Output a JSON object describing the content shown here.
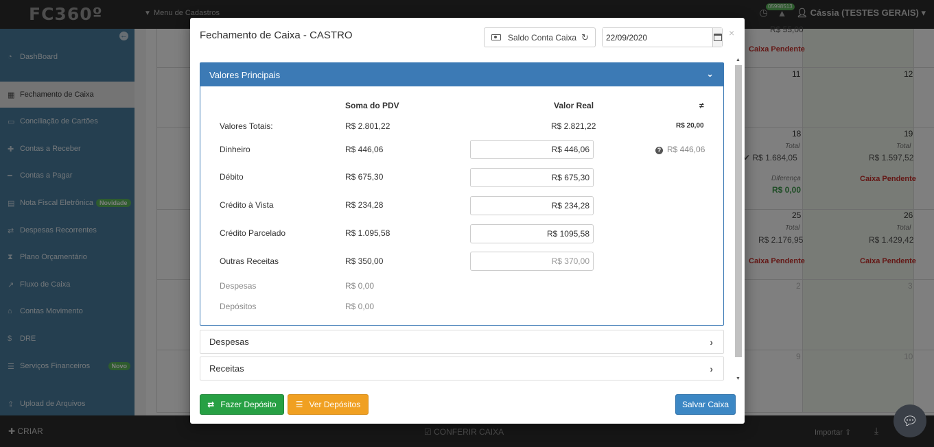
{
  "topbar": {
    "logo": "FC360º",
    "menu_cadastros": "Menu de Cadastros",
    "notification_count": "05998513",
    "user": "Cássia (TESTES GERAIS)"
  },
  "sidebar": {
    "items": [
      {
        "label": "DashBoard",
        "icon": "dashboard-icon"
      },
      {
        "label": "Fechamento de Caixa",
        "icon": "calendar-icon"
      },
      {
        "label": "Conciliação de Cartões",
        "icon": "credit-card-icon"
      },
      {
        "label": "Contas a Receber",
        "icon": "plus-icon"
      },
      {
        "label": "Contas a Pagar",
        "icon": "minus-icon"
      },
      {
        "label": "Nota Fiscal Eletrônica",
        "icon": "document-icon",
        "badge": "Novidade"
      },
      {
        "label": "Despesas Recorrentes",
        "icon": "recurring-icon"
      },
      {
        "label": "Plano Orçamentário",
        "icon": "hourglass-icon"
      },
      {
        "label": "Fluxo de Caixa",
        "icon": "line-chart-icon"
      },
      {
        "label": "Contas Movimento",
        "icon": "bank-icon"
      },
      {
        "label": "DRE",
        "icon": "dollar-icon"
      },
      {
        "label": "Serviços Financeiros",
        "icon": "list-icon",
        "badge": "Novo"
      },
      {
        "label": "Upload de Arquivos",
        "icon": "upload-icon"
      }
    ]
  },
  "bottombar": {
    "criar": "CRIAR",
    "conferir": "CONFERIR CAIXA",
    "importar": "Importar"
  },
  "calendar": {
    "days_row1": [
      "11",
      "12"
    ],
    "days_row2": [
      "18",
      "19"
    ],
    "days_row3": [
      "25",
      "26"
    ],
    "days_row4": [
      "2",
      "3"
    ],
    "days_row5": [
      "9",
      "10"
    ],
    "top_value": "R$ 55,00",
    "caixa_pendente": "Caixa Pendente",
    "total_label": "Total",
    "diferenca_label": "Diferença",
    "d18_total": "R$ 1.684,05",
    "d18_diff": "R$ 0,00",
    "d19_total": "R$ 1.597,52",
    "d25_total": "R$ 2.176,95",
    "d26_total": "R$ 1.429,42"
  },
  "modal": {
    "title": "Fechamento de Caixa - CASTRO",
    "saldo_button": "Saldo Conta Caixa",
    "date": "22/09/2020",
    "panel_title": "Valores Principais",
    "headers": {
      "pdv": "Soma do PDV",
      "real": "Valor Real",
      "diff": "≠"
    },
    "totals": {
      "label": "Valores Totais:",
      "pdv": "R$ 2.801,22",
      "real": "R$ 2.821,22",
      "diff": "R$ 20,00"
    },
    "rows": [
      {
        "label": "Dinheiro",
        "pdv": "R$ 446,06",
        "real": "R$ 446,06",
        "diff": "R$ 446,06"
      },
      {
        "label": "Débito",
        "pdv": "R$ 675,30",
        "real": "R$ 675,30"
      },
      {
        "label": "Crédito à Vista",
        "pdv": "R$ 234,28",
        "real": "R$ 234,28"
      },
      {
        "label": "Crédito Parcelado",
        "pdv": "R$ 1.095,58",
        "real": "R$ 1095,58"
      },
      {
        "label": "Outras Receitas",
        "pdv": "R$ 350,00",
        "real": "R$ 370,00"
      },
      {
        "label": "Despesas",
        "pdv": "R$ 0,00"
      },
      {
        "label": "Depósitos",
        "pdv": "R$ 0,00"
      }
    ],
    "panel_despesas": "Despesas",
    "panel_receitas": "Receitas",
    "btn_fazer_deposito": "Fazer Depósito",
    "btn_ver_depositos": "Ver Depósitos",
    "btn_salvar": "Salvar Caixa"
  }
}
